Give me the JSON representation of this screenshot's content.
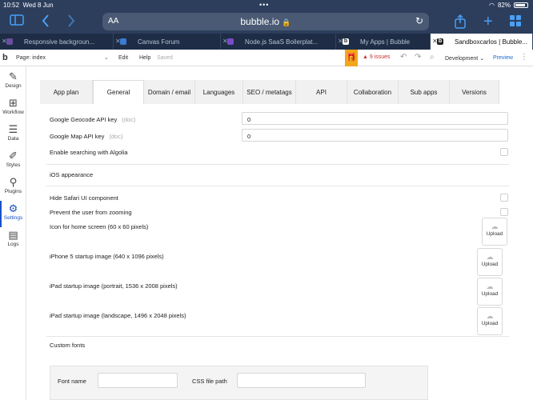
{
  "ios_status": {
    "time": "10:52",
    "date": "Wed 8 Jun",
    "battery": "82%"
  },
  "safari": {
    "aa_label": "AA",
    "url": "bubble.io",
    "tabs": [
      {
        "title": "Responsive backgroun...",
        "color": "#6b4f9e"
      },
      {
        "title": "Canvas Forum",
        "color": "#3a7bd5"
      },
      {
        "title": "Node.js SaaS Boilerplat...",
        "color": "#7a4ac9"
      },
      {
        "title": "My Apps | Bubble",
        "color": "#222222"
      },
      {
        "title": "Sandboxcarlos | Bubble...",
        "color": "#222222"
      }
    ]
  },
  "editor_bar": {
    "logo": "b",
    "page_label": "Page: index",
    "menu": [
      "Edit",
      "Help"
    ],
    "saved_label": "Saved",
    "issues_label": "9 issues",
    "environment": "Development",
    "preview_label": "Preview"
  },
  "sidebar": {
    "items": [
      {
        "label": "Design",
        "icon": "design-icon"
      },
      {
        "label": "Workflow",
        "icon": "workflow-icon"
      },
      {
        "label": "Data",
        "icon": "data-icon"
      },
      {
        "label": "Styles",
        "icon": "styles-icon"
      },
      {
        "label": "Plugins",
        "icon": "plugins-icon"
      },
      {
        "label": "Settings",
        "icon": "settings-icon",
        "active": true
      },
      {
        "label": "Logs",
        "icon": "logs-icon"
      }
    ]
  },
  "settings_tabs": [
    "App plan",
    "General",
    "Domain / email",
    "Languages",
    "SEO / metatags",
    "API",
    "Collaboration",
    "Sub apps",
    "Versions"
  ],
  "general": {
    "geocode_label": "Google Geocode API key",
    "geocode_doc": "(doc)",
    "geocode_value": "0",
    "map_label": "Google Map API key",
    "map_doc": "(doc)",
    "map_value": "0",
    "algolia_label": "Enable searching with Algolia",
    "ios_section": "iOS appearance",
    "hide_safari_label": "Hide Safari UI component",
    "prevent_zoom_label": "Prevent the user from zooming",
    "home_icon_label": "Icon for home screen (60 x 60 pixels)",
    "iphone5_label": "iPhone 5 startup image (640 x 1096 pixels)",
    "ipad_portrait_label": "iPad startup image (portrait, 1536 x 2008 pixels)",
    "ipad_landscape_label": "iPad startup image (landscape, 1496 x 2048 pixels)",
    "upload_label": "Upload",
    "custom_fonts_section": "Custom fonts",
    "font_name_label": "Font name",
    "css_path_label": "CSS file path"
  }
}
